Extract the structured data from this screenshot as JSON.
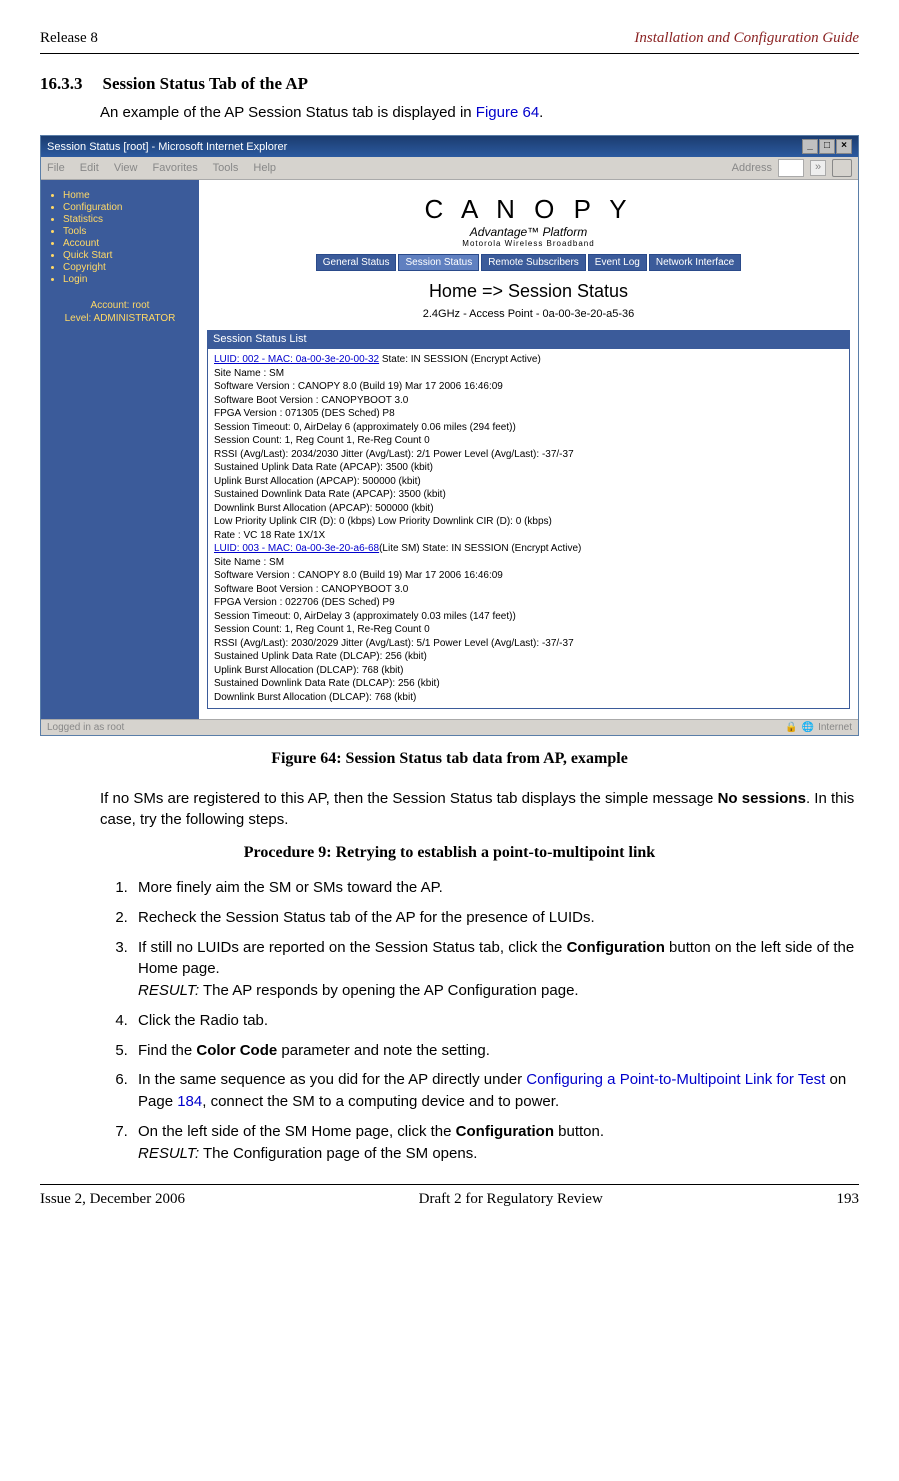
{
  "page_header": {
    "left": "Release 8",
    "right": "Installation and Configuration Guide"
  },
  "section": {
    "number": "16.3.3",
    "title": "Session Status Tab of the AP"
  },
  "intro": {
    "pre": "An example of the AP Session Status tab is displayed in ",
    "link": "Figure 64",
    "post": "."
  },
  "caption": "Figure 64: Session Status tab data from AP, example",
  "note": {
    "pre": "If no SMs are registered to this AP, then the Session Status tab displays the simple message ",
    "bold": "No sessions",
    "post": ". In this case, try the following steps."
  },
  "procedure_title": "Procedure 9: Retrying to establish a point-to-multipoint link",
  "steps": {
    "s1": "More finely aim the SM or SMs toward the AP.",
    "s2": "Recheck the Session Status tab of the AP for the presence of LUIDs.",
    "s3_pre": "If still no LUIDs are reported on the Session Status tab, click the ",
    "s3_bold": "Configuration",
    "s3_post": " button on the left side of the Home page.",
    "s3_result": " The AP responds by opening the AP Configuration page.",
    "s4": "Click the Radio tab.",
    "s5_pre": "Find the ",
    "s5_bold": "Color Code",
    "s5_post": " parameter and note the setting.",
    "s6_pre": "In the same sequence as you did for the AP directly under ",
    "s6_link": "Configuring a Point-to-Multipoint Link for Test",
    "s6_mid": " on Page ",
    "s6_page": "184",
    "s6_post": ", connect the SM to a computing device and to power.",
    "s7_pre": "On the left side of the SM Home page, click the ",
    "s7_bold": "Configuration",
    "s7_post": " button.",
    "s7_result": " The Configuration page of the SM opens."
  },
  "result_label": "RESULT:",
  "footer": {
    "left": "Issue 2, December 2006",
    "center": "Draft 2 for Regulatory Review",
    "right": "193"
  },
  "screenshot": {
    "title": "Session Status [root] - Microsoft Internet Explorer",
    "menus": [
      "File",
      "Edit",
      "View",
      "Favorites",
      "Tools",
      "Help"
    ],
    "address_label": "Address",
    "win_min": "_",
    "win_max": "□",
    "win_close": "×",
    "chev": "»",
    "sidebar": {
      "items": [
        "Home",
        "Configuration",
        "Statistics",
        "Tools",
        "Account",
        "Quick Start",
        "Copyright",
        "Login"
      ],
      "account1": "Account: root",
      "account2": "Level: ADMINISTRATOR"
    },
    "logo": {
      "big": "C A N O P Y",
      "mid": "Advantage™ Platform",
      "small": "Motorola Wireless Broadband"
    },
    "tabs": [
      "General Status",
      "Session Status",
      "Remote Subscribers",
      "Event Log",
      "Network Interface"
    ],
    "h1": "Home => Session Status",
    "sub": "2.4GHz - Access Point - 0a-00-3e-20-a5-36",
    "panel_head": "Session Status List",
    "entry1": {
      "luid": "LUID: 002 - MAC: 0a-00-3e-20-00-32",
      "state": " State: IN SESSION (Encrypt Active)",
      "l1": "Site Name : SM",
      "l2": "Software Version : CANOPY 8.0 (Build 19) Mar 17 2006 16:46:09",
      "l3": "Software Boot Version : CANOPYBOOT 3.0",
      "l4": "FPGA Version : 071305 (DES Sched) P8",
      "l5": "Session Timeout: 0, AirDelay 6 (approximately 0.06 miles (294 feet))",
      "l6": "Session Count: 1, Reg Count 1, Re-Reg Count 0",
      "l7": "RSSI (Avg/Last): 2034/2030   Jitter (Avg/Last): 2/1   Power Level (Avg/Last): -37/-37",
      "l8": "Sustained Uplink Data Rate (APCAP): 3500 (kbit)",
      "l9": "Uplink Burst Allocation (APCAP): 500000 (kbit)",
      "l10": "Sustained Downlink Data Rate (APCAP): 3500 (kbit)",
      "l11": "Downlink Burst Allocation (APCAP): 500000 (kbit)",
      "l12": "Low Priority Uplink CIR (D): 0 (kbps) Low Priority Downlink CIR (D): 0 (kbps)",
      "l13": "Rate : VC 18 Rate 1X/1X"
    },
    "entry2": {
      "luid": "LUID: 003 - MAC: 0a-00-3e-20-a6-68",
      "state": "(Lite SM) State: IN SESSION (Encrypt Active)",
      "l1": "Site Name : SM",
      "l2": "Software Version : CANOPY 8.0 (Build 19) Mar 17 2006 16:46:09",
      "l3": "Software Boot Version : CANOPYBOOT 3.0",
      "l4": "FPGA Version : 022706 (DES Sched) P9",
      "l5": "Session Timeout: 0, AirDelay 3 (approximately 0.03 miles (147 feet))",
      "l6": "Session Count: 1, Reg Count 1, Re-Reg Count 0",
      "l7": "RSSI (Avg/Last): 2030/2029   Jitter (Avg/Last): 5/1   Power Level (Avg/Last): -37/-37",
      "l8": "Sustained Uplink Data Rate (DLCAP): 256 (kbit)",
      "l9": "Uplink Burst Allocation (DLCAP): 768 (kbit)",
      "l10": "Sustained Downlink Data Rate (DLCAP): 256 (kbit)",
      "l11": "Downlink Burst Allocation (DLCAP): 768 (kbit)"
    },
    "status_left": "Logged in as root",
    "status_right": "Internet"
  }
}
